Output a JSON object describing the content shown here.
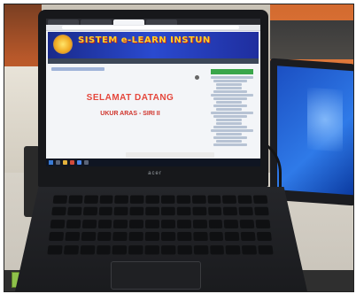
{
  "browser": {
    "tabs": [
      "",
      "",
      "",
      ""
    ]
  },
  "site": {
    "banner_title": "SISTEM e-LEARN INSTUN",
    "nav_text": "",
    "breadcrumb": "",
    "main_label": "",
    "category_label": ""
  },
  "content": {
    "welcome": "SELAMAT DATANG",
    "year": "",
    "event": "UKUR ARAS - SIRI II"
  },
  "laptop": {
    "brand": "acer"
  },
  "colors": {
    "banner": "#2a4ad0",
    "welcome_text": "#e5473c",
    "accent_green": "#3aa64a"
  }
}
